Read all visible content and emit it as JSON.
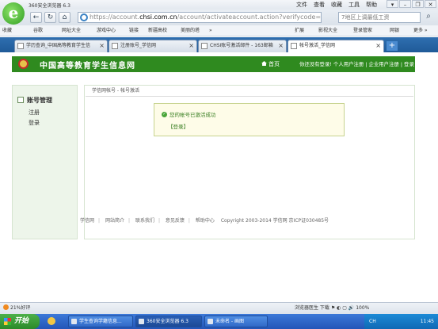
{
  "browser": {
    "title": "360安全浏览器 6.3",
    "menus": [
      "文件",
      "查看",
      "收藏",
      "工具",
      "帮助"
    ],
    "window_buttons": [
      "▾",
      "–",
      "❐",
      "✕"
    ],
    "address": {
      "prefix": "https://account.",
      "domain": "chsi.com.cn",
      "path": "/account/activateaccount.action?verifycode=52368b"
    },
    "search_text": "7地区上调最低工资",
    "favorites": [
      "收藏",
      "谷歌",
      "网址大全",
      "游戏中心",
      "链接",
      "新疆高校",
      "美丽的塔",
      "»",
      "扩展",
      "影视大全",
      "登录管家",
      "网银",
      "更多 »"
    ],
    "tabs": [
      {
        "label": "学历查询_中国高等教育学生信",
        "active": false
      },
      {
        "label": "注册账号_学信网",
        "active": false
      },
      {
        "label": "CHSI账号激活邮件 - 163邮箱",
        "active": false
      },
      {
        "label": "帐号激活_学信网",
        "active": true
      }
    ]
  },
  "site": {
    "name": "中国高等教育学生信息网",
    "home_link": "首页",
    "header_links": "你还没有登录! 个人用户注册 | 企业用户注册 | 登录 | 帮助"
  },
  "sidebar": {
    "heading": "账号管理",
    "links": [
      "注册",
      "登录"
    ]
  },
  "content": {
    "breadcrumb": "学信网帐号 - 帐号激活",
    "notice_message": "您的帐号已激活成功",
    "login_link": "【登录】"
  },
  "footer": {
    "links": [
      "学信网",
      "网站简介",
      "联系我们",
      "意见反馈",
      "帮助中心"
    ],
    "copyright": "Copyright 2003-2014 学信网 京ICP证030485号"
  },
  "statusbar": {
    "left": "21%好评",
    "right": "浏览器医生   下载   ⚑   ◐   ▢   🔊 100%"
  },
  "taskbar": {
    "start": "开始",
    "items": [
      {
        "label": "学生查询学籍信息...",
        "active": false
      },
      {
        "label": "360安全浏览器 6.3",
        "active": true
      },
      {
        "label": "未命名 - 画图",
        "active": false
      }
    ],
    "lang": "CH",
    "clock": "11:45"
  }
}
